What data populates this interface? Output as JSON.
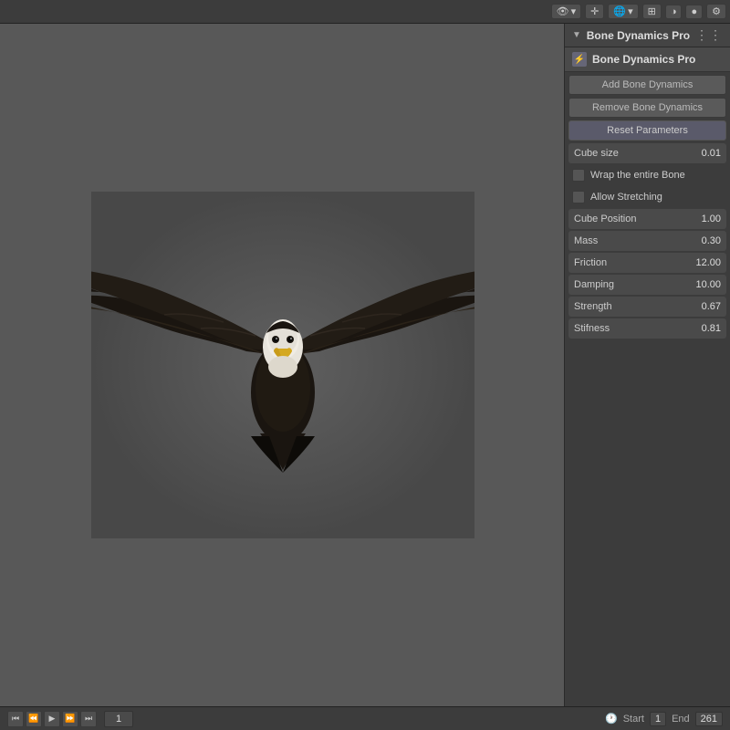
{
  "topToolbar": {
    "items": [
      {
        "id": "view-icon",
        "label": "👁"
      },
      {
        "id": "cursor-icon",
        "label": "✛"
      },
      {
        "id": "globe-icon",
        "label": "🌐"
      },
      {
        "id": "grid-icon",
        "label": "⊞"
      },
      {
        "id": "shading1-icon",
        "label": "◑"
      },
      {
        "id": "shading2-icon",
        "label": "●"
      },
      {
        "id": "settings-icon",
        "label": "⚙"
      }
    ]
  },
  "panel": {
    "title": "Bone Dynamics Pro",
    "subTitle": "Bone Dynamics Pro",
    "buttons": {
      "addBoneDynamics": "Add Bone Dynamics",
      "removeBoneDynamics": "Remove Bone Dynamics",
      "resetParameters": "Reset Parameters"
    },
    "cubeSizeLabel": "Cube size",
    "cubeSizeValue": "0.01",
    "wrapLabel": "Wrap the entire Bone",
    "allowStretchingLabel": "Allow Stretching",
    "fields": [
      {
        "label": "Cube Position",
        "value": "1.00"
      },
      {
        "label": "Mass",
        "value": "0.30"
      },
      {
        "label": "Friction",
        "value": "12.00"
      },
      {
        "label": "Damping",
        "value": "10.00"
      },
      {
        "label": "Strength",
        "value": "0.67"
      },
      {
        "label": "Stifness",
        "value": "0.81"
      }
    ]
  },
  "bottomBar": {
    "frameValue": "1",
    "startLabel": "Start",
    "startValue": "1",
    "endLabel": "End",
    "endValue": "261",
    "clockIcon": "🕐"
  }
}
